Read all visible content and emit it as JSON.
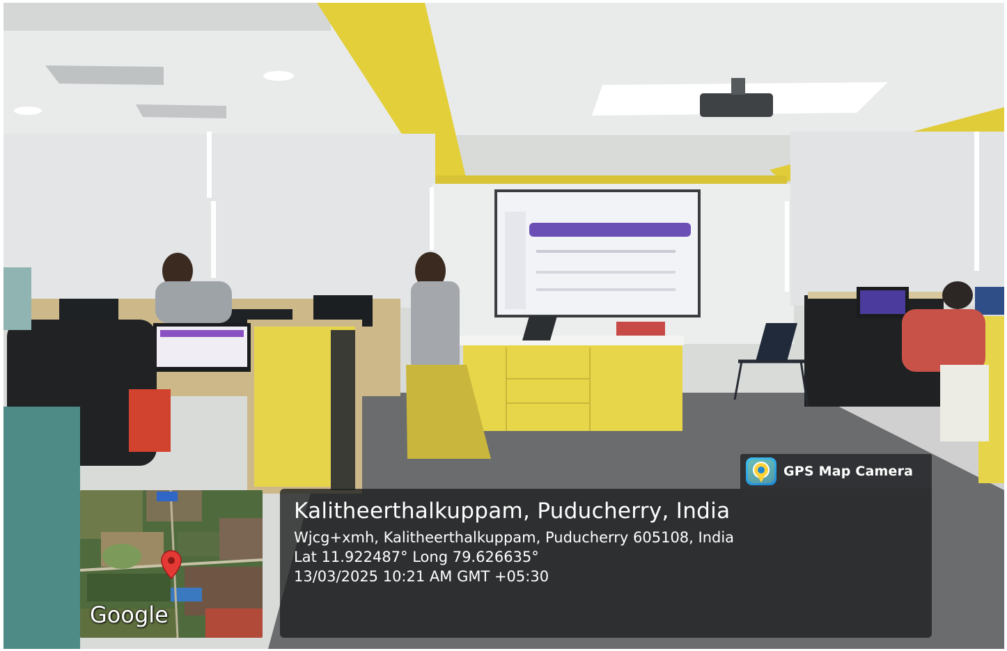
{
  "overlay": {
    "app_name": "GPS Map Camera",
    "app_icon": "map-pin-camera-icon",
    "place_title": "Kalitheerthalkuppam, Puducherry, India",
    "address": "Wjcg+xmh, Kalitheerthalkuppam, Puducherry 605108, India",
    "coordinates": "Lat 11.922487° Long 79.626635°",
    "datetime": "13/03/2025 10:21 AM GMT +05:30"
  },
  "map": {
    "logo_text": "Google",
    "marker_icon": "location-pin-icon",
    "marker_color": "#e53935"
  },
  "colors": {
    "panel_bg": "#1e2021",
    "accent_yellow": "#e6d23a",
    "screen_purple": "#6b4fb5"
  }
}
